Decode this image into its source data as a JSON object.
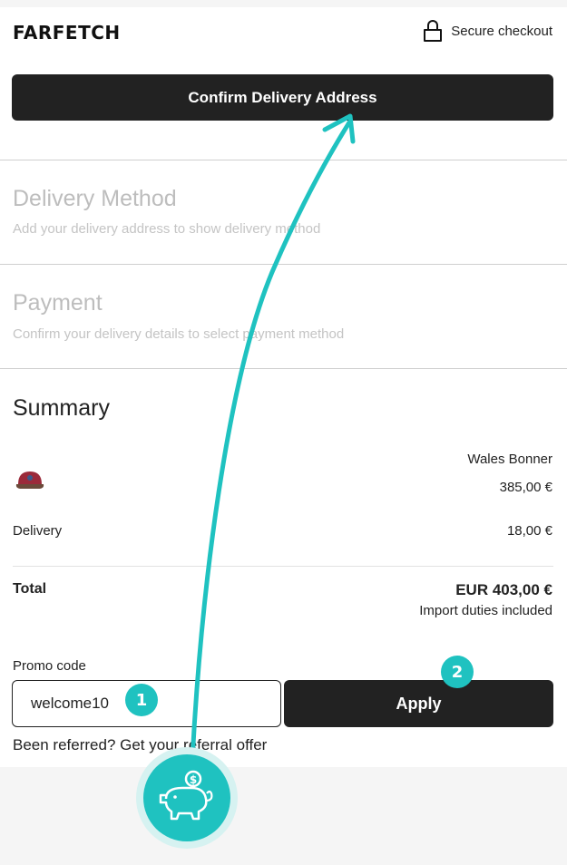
{
  "header": {
    "logo": "FARFETCH",
    "secure_label": "Secure checkout"
  },
  "confirm_button": "Confirm Delivery Address",
  "delivery_method": {
    "title": "Delivery Method",
    "subtitle": "Add your delivery address to show delivery method"
  },
  "payment": {
    "title": "Payment",
    "subtitle": "Confirm your delivery details to select payment method"
  },
  "summary": {
    "title": "Summary",
    "item": {
      "brand": "Wales Bonner",
      "price": "385,00 €"
    },
    "delivery_label": "Delivery",
    "delivery_value": "18,00 €",
    "total_label": "Total",
    "total_value": "EUR 403,00 €",
    "duties_note": "Import duties included"
  },
  "promo": {
    "label": "Promo code",
    "value": "welcome10",
    "apply_label": "Apply",
    "referral_text": "Been referred? Get your referral offer"
  },
  "annotations": {
    "step1": "1",
    "step2": "2",
    "accent_color": "#1fc2c0"
  }
}
